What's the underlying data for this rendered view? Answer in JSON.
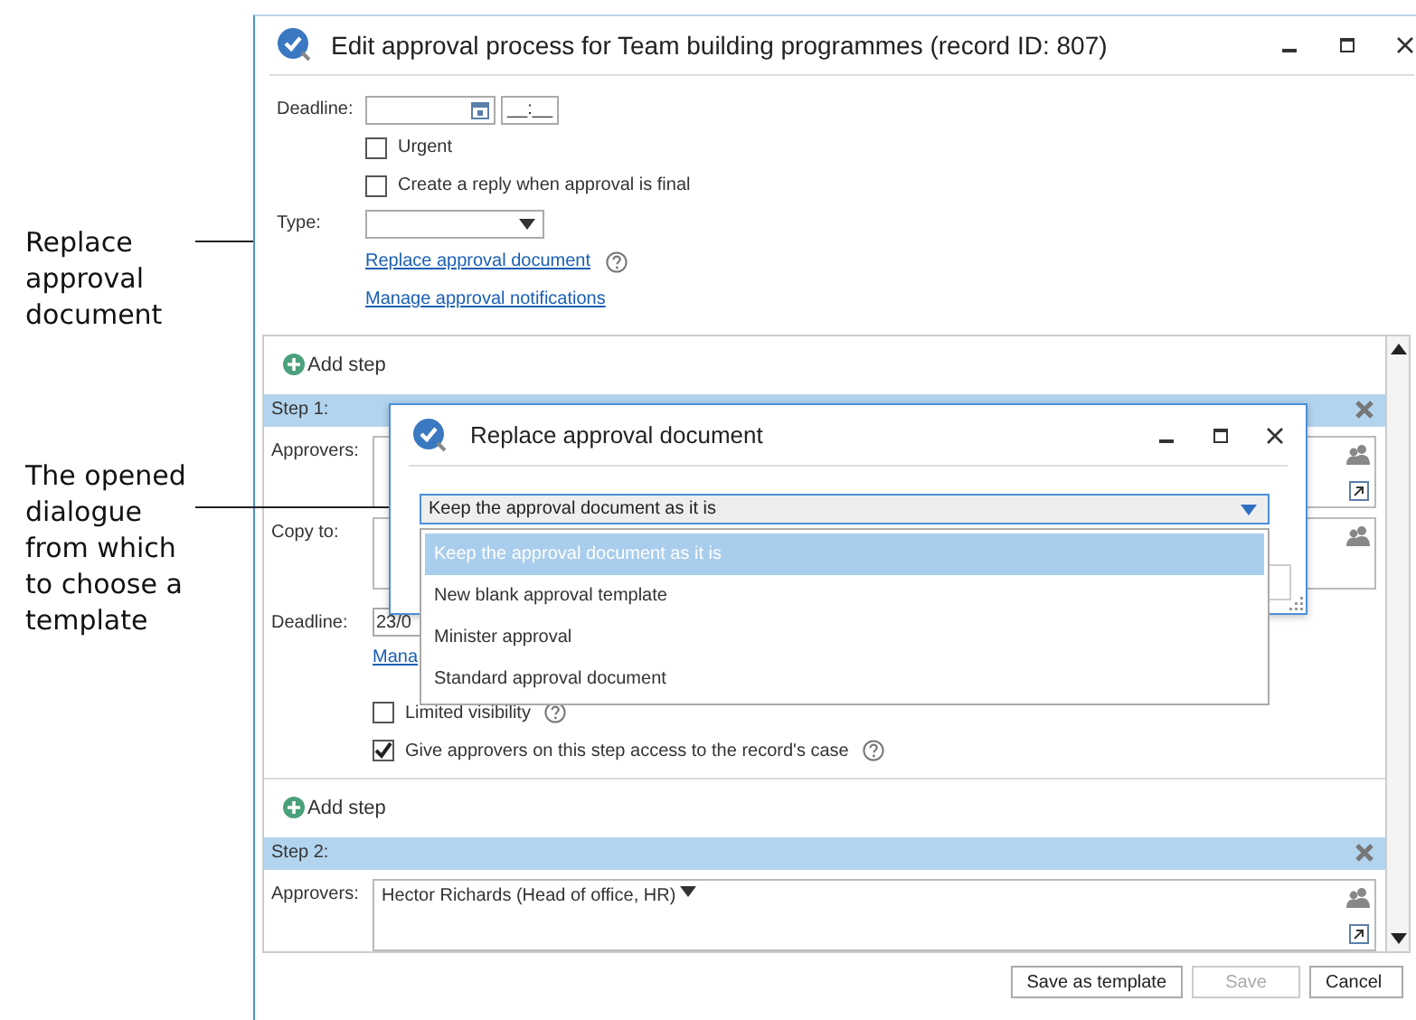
{
  "annotations": [
    {
      "text": "Replace approval document"
    },
    {
      "text": "The opened dialogue from which to choose a template"
    }
  ],
  "window": {
    "title": "Edit approval process for Team building programmes (record ID: 807)",
    "deadline": {
      "label": "Deadline:",
      "time": "__:__"
    },
    "options": [
      {
        "label": "Urgent",
        "checked": false
      },
      {
        "label": "Create a reply when approval is final",
        "checked": false
      }
    ],
    "type": {
      "label": "Type:"
    },
    "links": [
      {
        "label": "Replace approval document",
        "help": true
      },
      {
        "label": "Manage approval notifications",
        "help": false
      }
    ],
    "steps_panel": {
      "items": [
        {
          "kind": "add_step",
          "label": "Add step"
        },
        {
          "kind": "step",
          "title": "Step 1:",
          "fields": [
            {
              "label": "Approvers:",
              "people": true,
              "expand": true
            },
            {
              "label": "Copy to:",
              "people": true,
              "expand": false
            }
          ],
          "deadline": {
            "label": "Deadline:",
            "value": "23/0"
          },
          "link": "Mana",
          "options": [
            {
              "label": "Limited visibility",
              "checked": false,
              "help": true
            },
            {
              "label": "Give approvers on this step access to the record's case",
              "checked": true,
              "help": true
            }
          ]
        },
        {
          "kind": "add_step",
          "label": "Add step"
        },
        {
          "kind": "step",
          "title": "Step 2:",
          "fields": [
            {
              "label": "Approvers:",
              "value": "Hector Richards (Head of office, HR)",
              "caret": true,
              "people": true,
              "expand": true
            }
          ]
        }
      ]
    },
    "buttons": [
      {
        "label": "Save as template",
        "disabled": false
      },
      {
        "label": "Save",
        "disabled": true
      },
      {
        "label": "Cancel",
        "disabled": false
      }
    ]
  },
  "dialog": {
    "title": "Replace approval document",
    "select": {
      "value": "Keep the approval document as it is"
    },
    "options": [
      {
        "label": "Keep the approval document as it is",
        "selected": true
      },
      {
        "label": "New blank approval template",
        "selected": false
      },
      {
        "label": "Minister approval",
        "selected": false
      },
      {
        "label": "Standard approval document",
        "selected": false
      }
    ]
  }
}
